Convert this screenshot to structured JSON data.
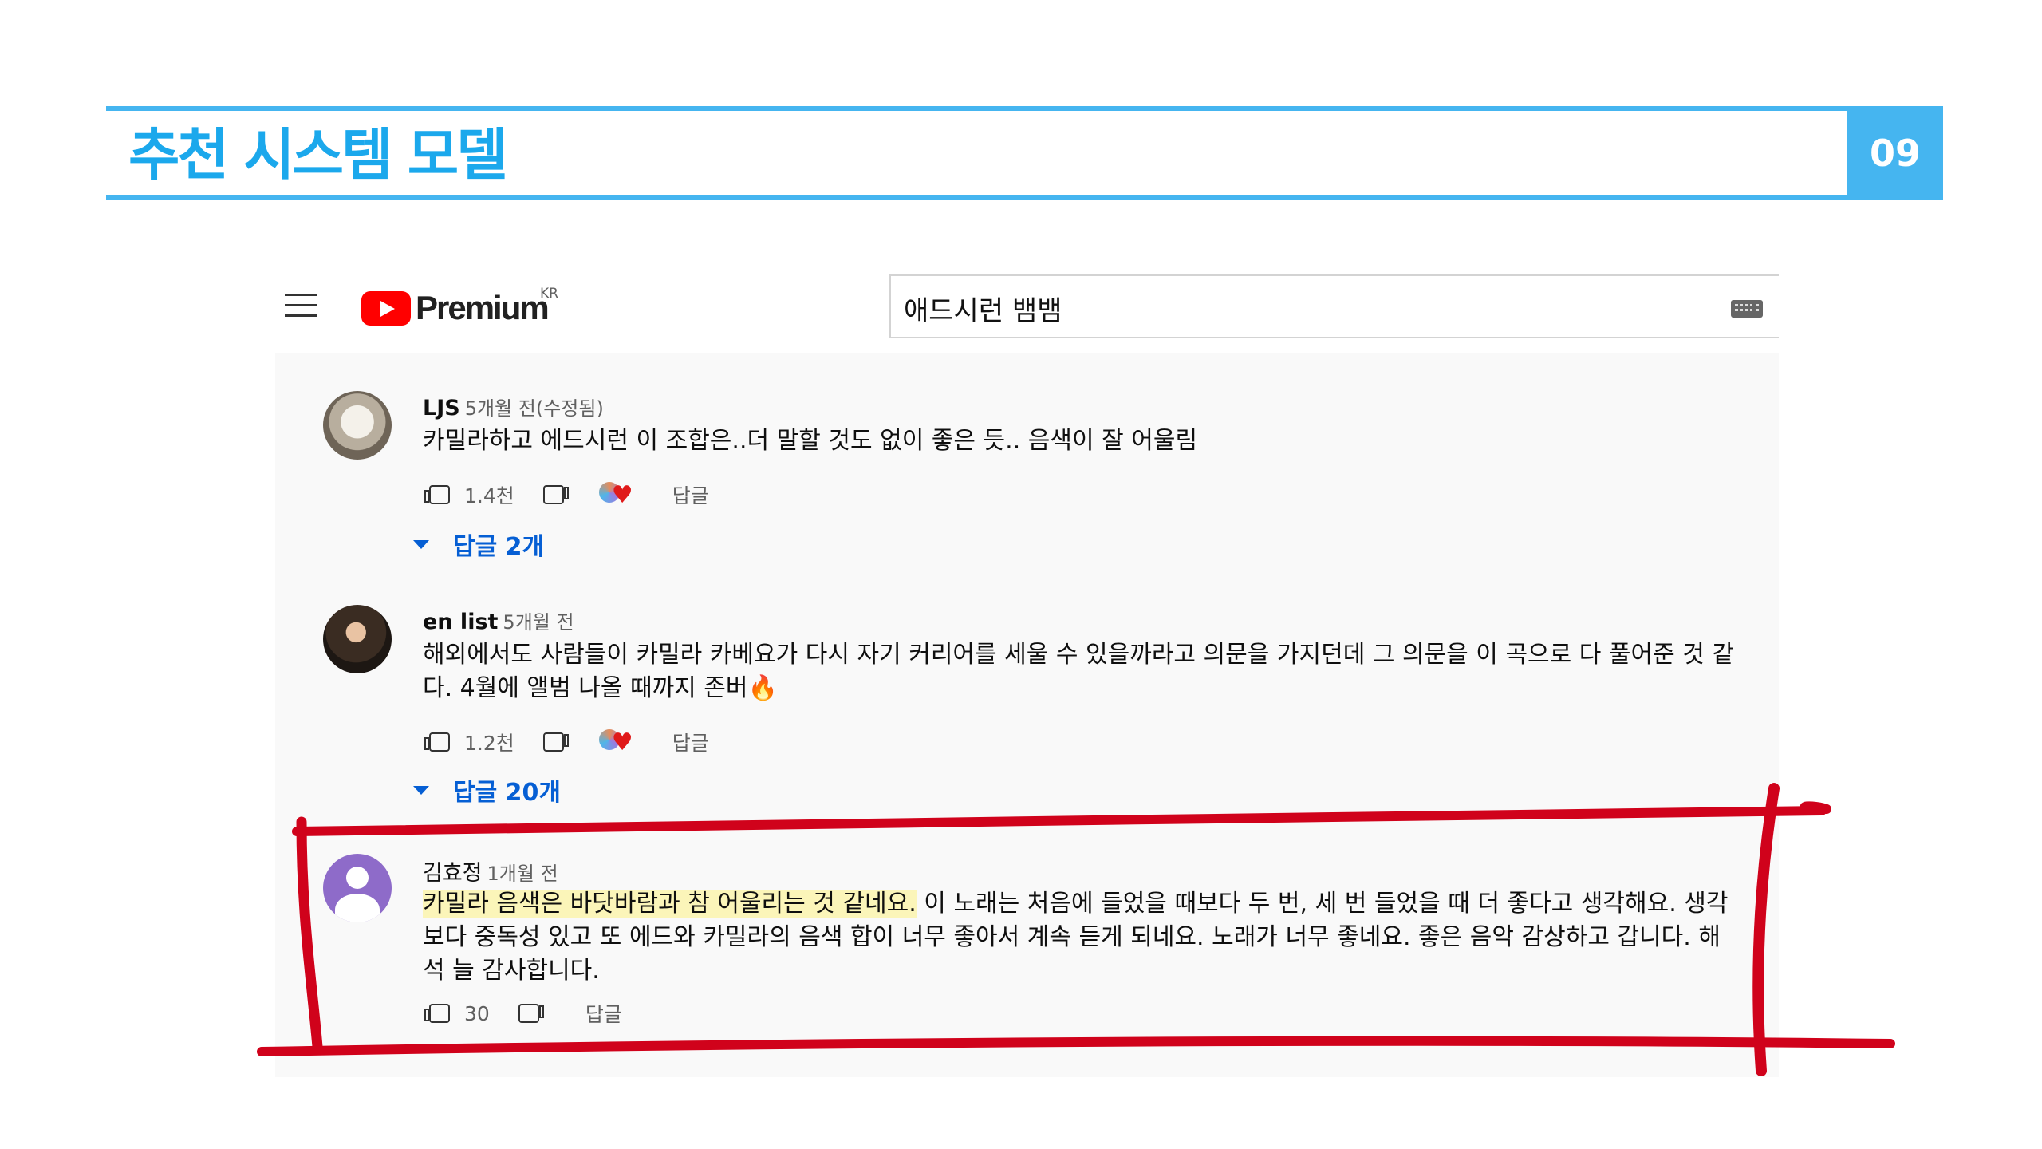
{
  "slide": {
    "title": "추천 시스템 모델",
    "page_number": "09"
  },
  "youtube": {
    "logo_text": "Premium",
    "logo_country": "KR",
    "search_value": "애드시런 뱀뱀",
    "reply_label": "답글"
  },
  "comments": [
    {
      "author": "LJS",
      "time": "5개월 전(수정됨)",
      "text": "카밀라하고 에드시런 이 조합은..더 말할 것도 없이 좋은 듯.. 음색이 잘 어울림",
      "likes": "1.4천",
      "replies": "답글 2개"
    },
    {
      "author": "en list",
      "time": "5개월 전",
      "text": "해외에서도 사람들이 카밀라 카베요가 다시 자기 커리어를 세울 수 있을까라고 의문을 가지던데 그 의문을 이 곡으로 다 풀어준 것 같다. 4월에 앨범 나올 때까지 존버🔥",
      "likes": "1.2천",
      "replies": "답글 20개"
    },
    {
      "author": "김효정",
      "time": "1개월 전",
      "text_highlight": "카밀라 음색은 바닷바람과 참 어울리는 것 같네요.",
      "text_rest": " 이 노래는 처음에 들었을 때보다 두 번, 세 번 들었을 때 더 좋다고 생각해요. 생각보다 중독성 있고 또 에드와 카밀라의 음색 합이 너무 좋아서 계속 듣게 되네요. 노래가 너무 좋네요. 좋은 음악 감상하고 갑니다. 해석 늘 감사합니다.",
      "likes": "30"
    }
  ],
  "colors": {
    "header_accent": "#45b5f0",
    "title_color": "#1ba8ec",
    "annotation_red": "#d0021b",
    "highlight": "#fbf5b9"
  }
}
